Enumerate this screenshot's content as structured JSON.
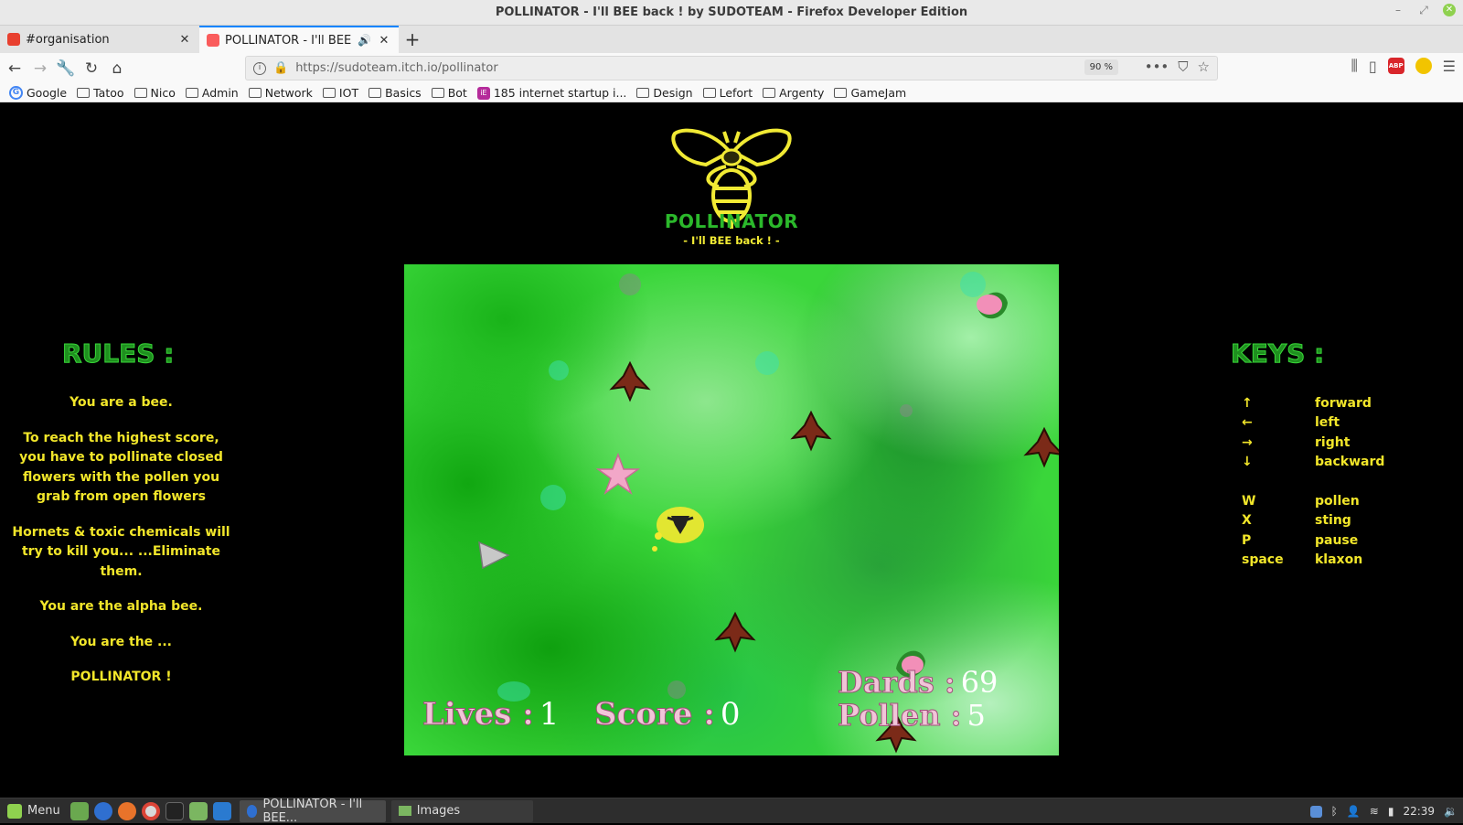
{
  "window": {
    "title": "POLLINATOR - I'll BEE back ! by SUDOTEAM - Firefox Developer Edition"
  },
  "tabs": [
    {
      "label": "#organisation",
      "close": "✕"
    },
    {
      "label": "POLLINATOR - I'll BEE back",
      "close": "✕"
    }
  ],
  "newtab": "+",
  "nav": {
    "url": "https://sudoteam.itch.io/pollinator",
    "zoom": "90 %"
  },
  "bookmarks": [
    {
      "label": "Google",
      "type": "google"
    },
    {
      "label": "Tatoo",
      "type": "folder"
    },
    {
      "label": "Nico",
      "type": "folder"
    },
    {
      "label": "Admin",
      "type": "folder"
    },
    {
      "label": "Network",
      "type": "folder"
    },
    {
      "label": "IOT",
      "type": "folder"
    },
    {
      "label": "Basics",
      "type": "folder"
    },
    {
      "label": "Bot",
      "type": "folder"
    },
    {
      "label": "185 internet startup i...",
      "type": "site"
    },
    {
      "label": "Design",
      "type": "folder"
    },
    {
      "label": "Lefort",
      "type": "folder"
    },
    {
      "label": "Argenty",
      "type": "folder"
    },
    {
      "label": "GameJam",
      "type": "folder"
    }
  ],
  "logo": {
    "title": "POLLINATOR",
    "subtitle": "- I'll BEE back ! -"
  },
  "rules": {
    "title": "RULES :",
    "paragraphs": [
      "You are a bee.",
      "To reach the highest score, you have to pollinate closed flowers with the pollen you grab from open flowers",
      "Hornets & toxic chemicals will try to kill you... ...Eliminate them.",
      "You are the alpha bee.",
      "You are the ...",
      "POLLINATOR !"
    ]
  },
  "keys": {
    "title": "KEYS :",
    "movement": [
      {
        "key": "↑",
        "action": "forward"
      },
      {
        "key": "←",
        "action": "left"
      },
      {
        "key": "→",
        "action": "right"
      },
      {
        "key": "↓",
        "action": "backward"
      }
    ],
    "actions": [
      {
        "key": "W",
        "action": "pollen"
      },
      {
        "key": "X",
        "action": "sting"
      },
      {
        "key": "P",
        "action": "pause"
      },
      {
        "key": "space",
        "action": "klaxon"
      }
    ]
  },
  "hud": {
    "lives_label": "Lives :",
    "lives": "1",
    "score_label": "Score :",
    "score": "0",
    "dards_label": "Dards :",
    "dards": "69",
    "pollen_label": "Pollen :",
    "pollen": "5"
  },
  "taskbar": {
    "menu": "Menu",
    "tasks": [
      "POLLINATOR - I'll BEE...",
      "Images"
    ],
    "clock": "22:39"
  },
  "colors": {
    "rules_text": "#f2e62a",
    "title_green": "#1f8f1f",
    "tab_accent": "#0a84ff"
  }
}
